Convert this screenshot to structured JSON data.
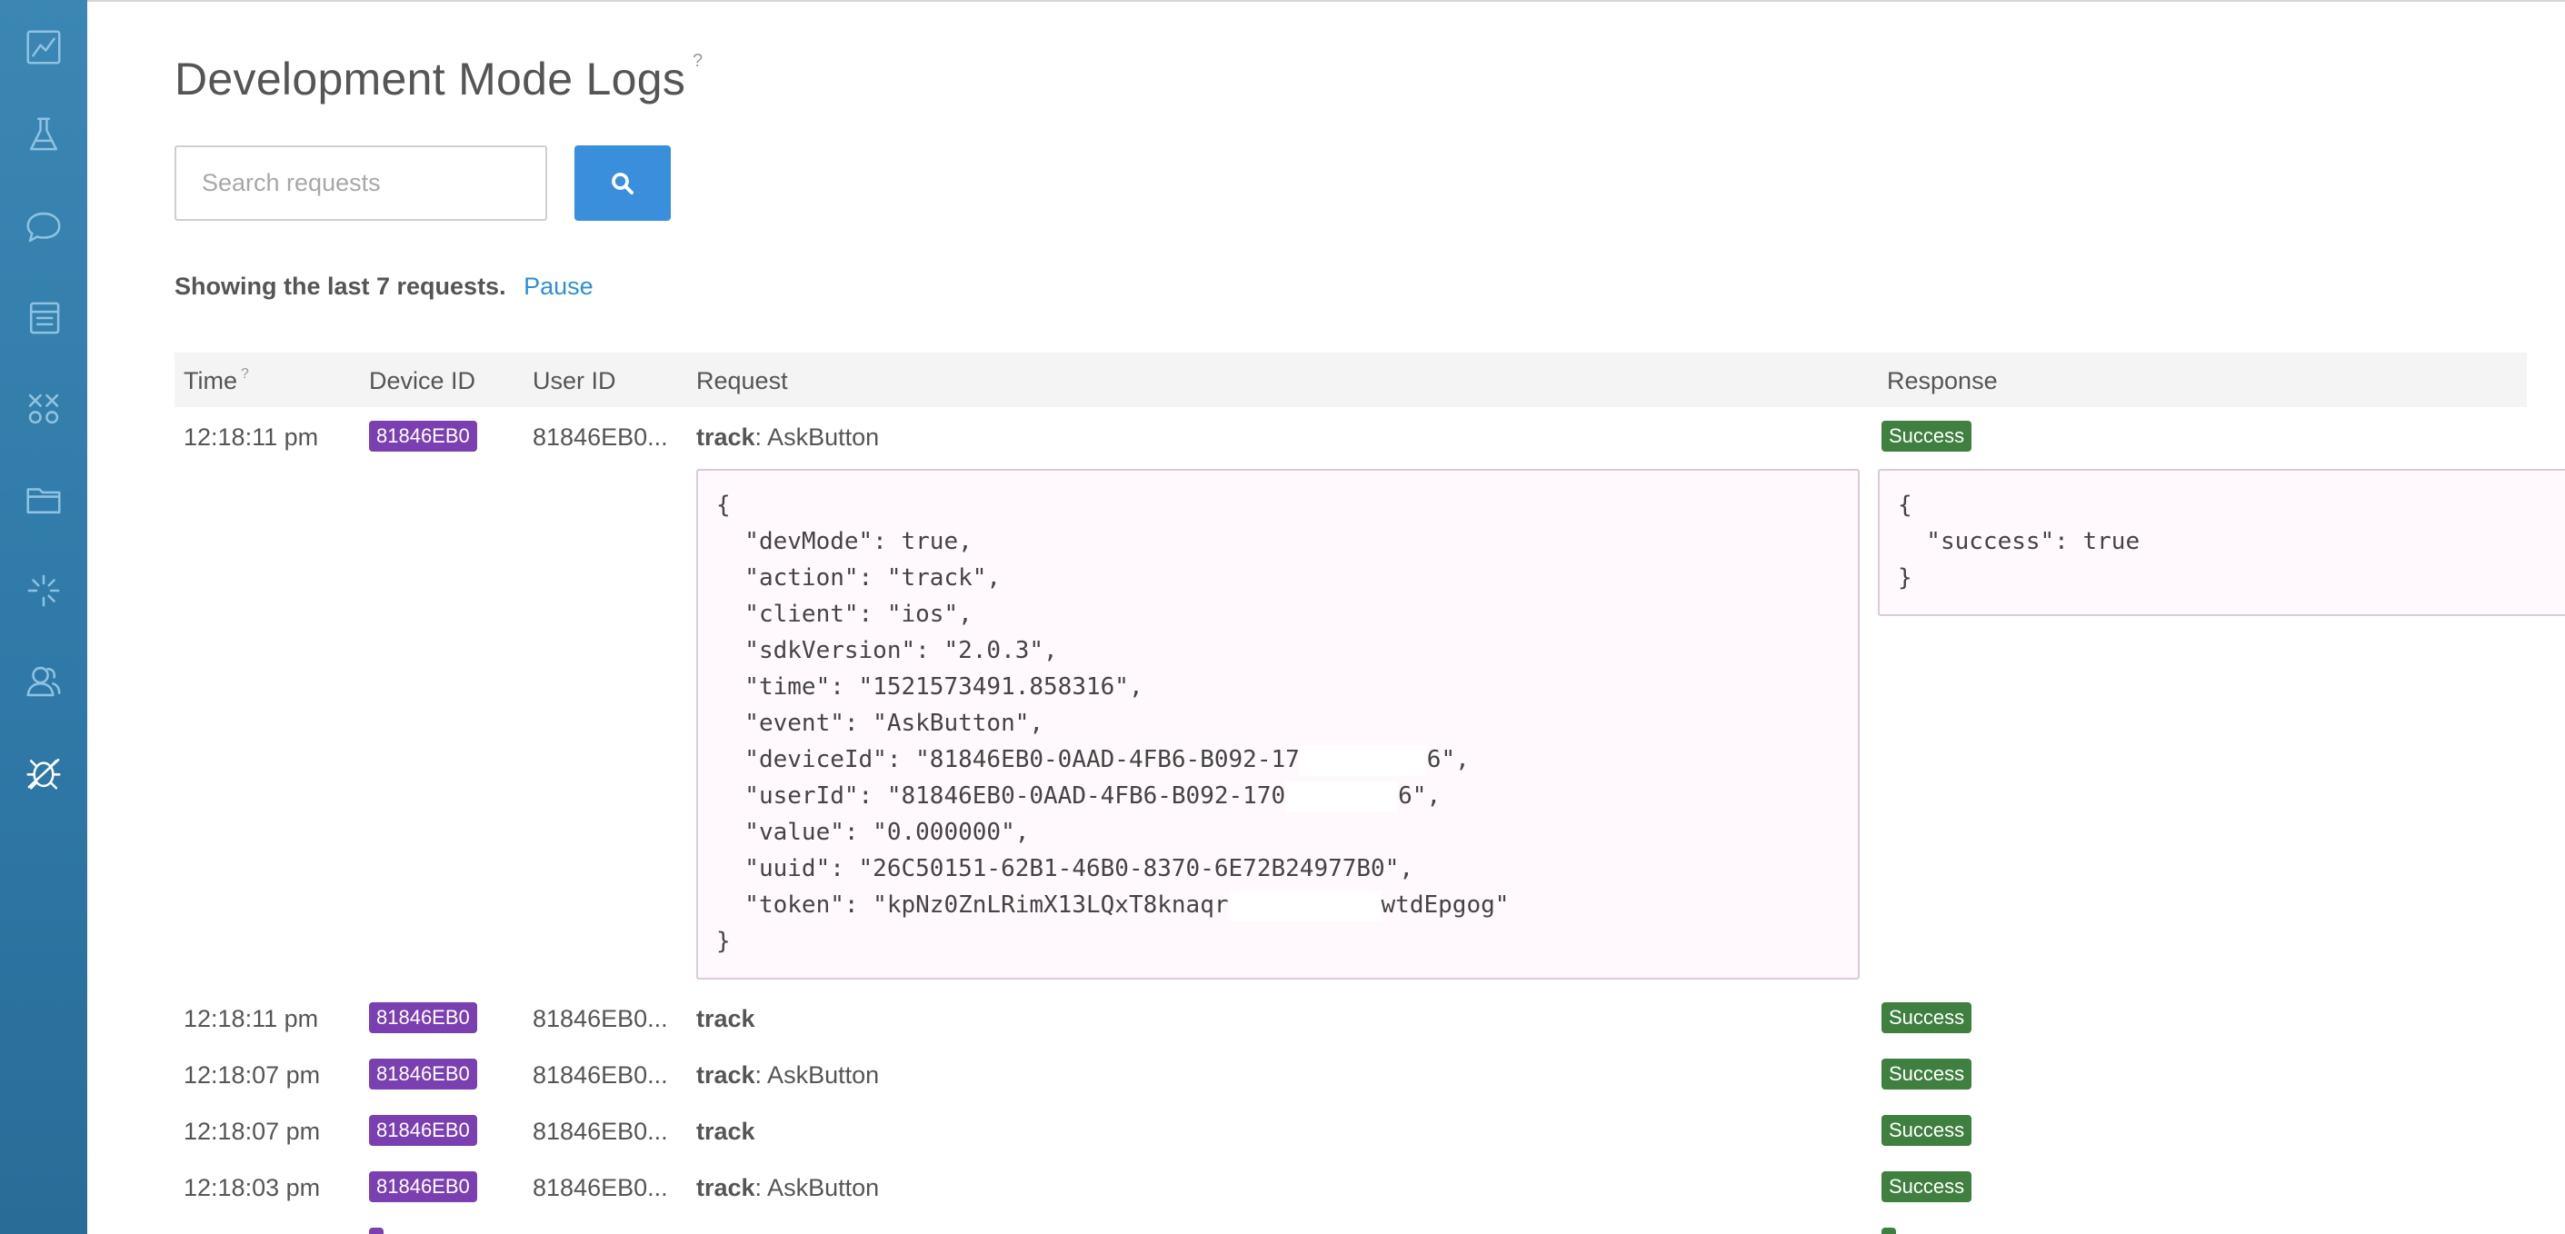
{
  "page": {
    "title": "Development Mode Logs",
    "title_help": "?"
  },
  "search": {
    "placeholder": "Search requests",
    "value": "",
    "button_icon": "search-icon"
  },
  "status": {
    "text": "Showing the last 7 requests.",
    "pause_label": "Pause"
  },
  "sidebar": {
    "items": [
      {
        "icon": "analytics-chart-icon",
        "active": false
      },
      {
        "icon": "flask-icon",
        "active": false
      },
      {
        "icon": "chat-bubble-icon",
        "active": false
      },
      {
        "icon": "messages-stack-icon",
        "active": false
      },
      {
        "icon": "variables-icon",
        "active": false
      },
      {
        "icon": "folder-icon",
        "active": false
      },
      {
        "icon": "loading-spinner-icon",
        "active": false
      },
      {
        "icon": "users-icon",
        "active": false
      },
      {
        "icon": "debug-bug-icon",
        "active": true
      }
    ]
  },
  "table": {
    "headers": {
      "time": "Time",
      "time_help": "?",
      "device_id": "Device ID",
      "user_id": "User ID",
      "request": "Request",
      "response": "Response"
    },
    "rows": [
      {
        "time": "12:18:11 pm",
        "device_id": "81846EB0",
        "user_id": "81846EB0...",
        "type": "track",
        "event": ": AskButton",
        "response": "Success"
      },
      {
        "time": "12:18:11 pm",
        "device_id": "81846EB0",
        "user_id": "81846EB0...",
        "type": "track",
        "event": "",
        "response": "Success"
      },
      {
        "time": "12:18:07 pm",
        "device_id": "81846EB0",
        "user_id": "81846EB0...",
        "type": "track",
        "event": ": AskButton",
        "response": "Success"
      },
      {
        "time": "12:18:07 pm",
        "device_id": "81846EB0",
        "user_id": "81846EB0...",
        "type": "track",
        "event": "",
        "response": "Success"
      },
      {
        "time": "12:18:03 pm",
        "device_id": "81846EB0",
        "user_id": "81846EB0...",
        "type": "track",
        "event": ": AskButton",
        "response": "Success"
      }
    ]
  },
  "expanded": {
    "request_lines": {
      "open": "{",
      "devMode": "  \"devMode\": true,",
      "action": "  \"action\": \"track\",",
      "client": "  \"client\": \"ios\",",
      "sdkVersion": "  \"sdkVersion\": \"2.0.3\",",
      "time": "  \"time\": \"1521573491.858316\",",
      "event": "  \"event\": \"AskButton\",",
      "deviceId_a": "  \"deviceId\": \"81846EB0-0AAD-4FB6-B092-17",
      "deviceId_b": "6\",",
      "userId_a": "  \"userId\": \"81846EB0-0AAD-4FB6-B092-170",
      "userId_b": "6\",",
      "value": "  \"value\": \"0.000000\",",
      "uuid": "  \"uuid\": \"26C50151-62B1-46B0-8370-6E72B24977B0\",",
      "token_a": "  \"token\": \"kpNz0ZnLRimX13LQxT8knaqr",
      "token_b": "wtdEpgog\"",
      "close": "}"
    },
    "response_lines": {
      "open": "{",
      "success": "  \"success\": true",
      "close": "}"
    }
  },
  "colors": {
    "sidebar": "#2f79a8",
    "search_button": "#3a8fdc",
    "device_badge": "#7a3fb0",
    "success_badge": "#3f7f3f",
    "link": "#2e8fd6"
  }
}
